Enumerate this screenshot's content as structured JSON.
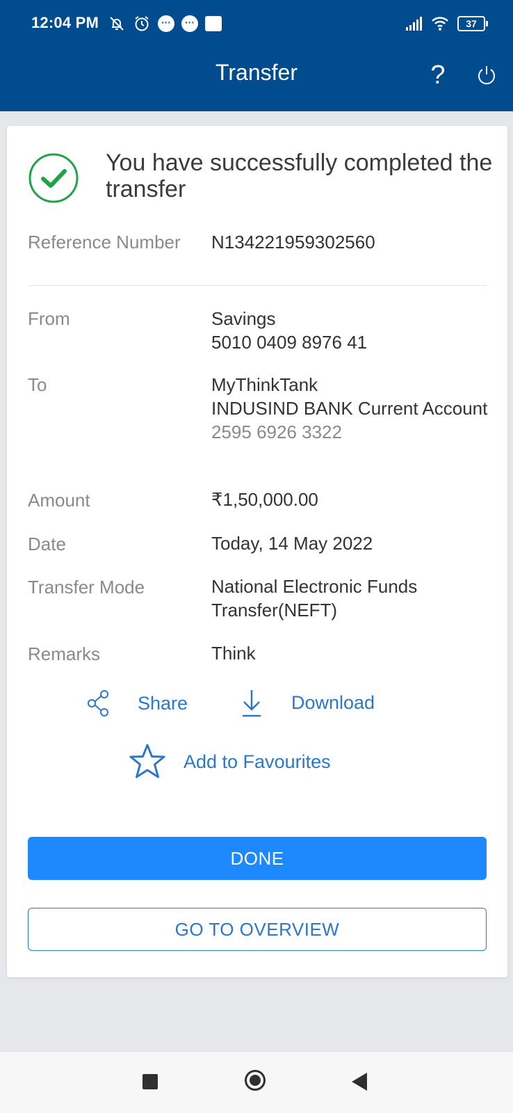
{
  "status_bar": {
    "time": "12:04 PM",
    "battery": "37"
  },
  "header": {
    "title": "Transfer",
    "help_label": "?"
  },
  "success": {
    "message": "You have successfully completed the transfer"
  },
  "details": {
    "reference": {
      "label": "Reference Number",
      "value": "N134221959302560"
    },
    "from": {
      "label": "From",
      "line1": "Savings",
      "line2": "5010 0409 8976 41"
    },
    "to": {
      "label": "To",
      "name": "MyThinkTank",
      "bank": "INDUSIND BANK Current Account",
      "account": "2595 6926 3322"
    },
    "amount": {
      "label": "Amount",
      "value": "₹1,50,000.00"
    },
    "date": {
      "label": "Date",
      "value": "Today, 14 May 2022"
    },
    "mode": {
      "label": "Transfer Mode",
      "value": "National Electronic Funds Transfer(NEFT)"
    },
    "remarks": {
      "label": "Remarks",
      "value": "Think"
    }
  },
  "actions": {
    "share": "Share",
    "download": "Download",
    "favourite": "Add to Favourites"
  },
  "buttons": {
    "done": "DONE",
    "overview": "GO TO OVERVIEW"
  },
  "colors": {
    "header_bg": "#004c8f",
    "primary": "#1e88ff",
    "link": "#2a78c7",
    "success": "#1fa34a"
  },
  "icons": [
    "muted-bell-icon",
    "alarm-icon",
    "chat-bubble-icon",
    "signal-icon",
    "wifi-icon",
    "battery-icon",
    "help-icon",
    "power-icon",
    "check-circle-icon",
    "share-icon",
    "download-icon",
    "star-icon"
  ]
}
